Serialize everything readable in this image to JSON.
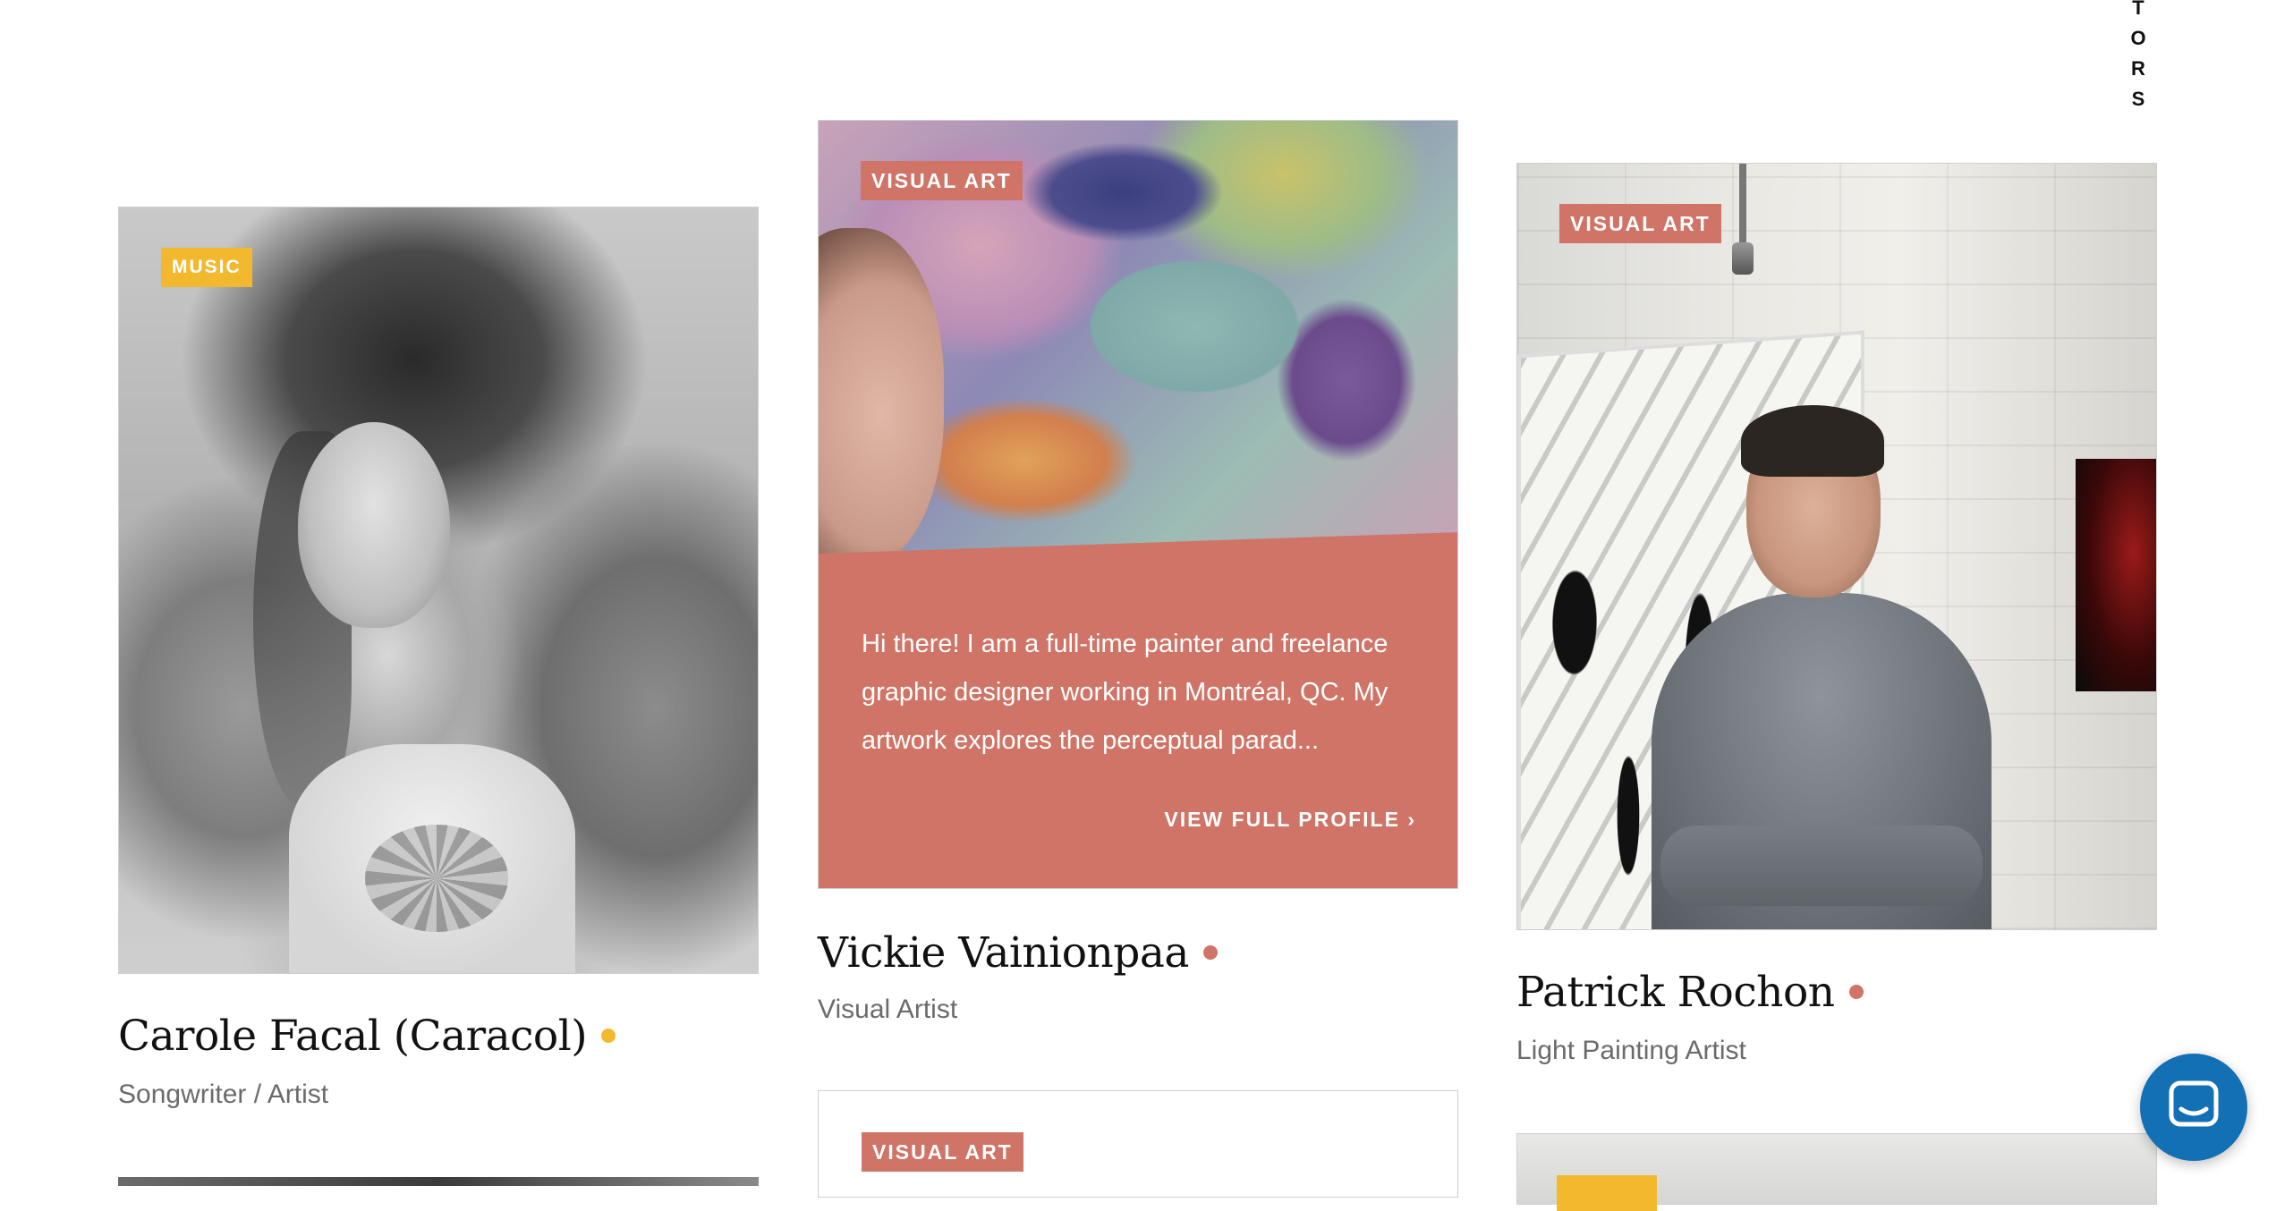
{
  "side_nav": {
    "letters": [
      "T",
      "O",
      "R",
      "S"
    ]
  },
  "cards": [
    {
      "category": "MUSIC",
      "name": "Carole Facal (Caracol)",
      "role": "Songwriter / Artist",
      "category_color": "#f2b92e"
    },
    {
      "category": "VISUAL ART",
      "name": "Vickie Vainionpaa",
      "role": "Visual Artist",
      "bio": "Hi there! I am a full-time painter and freelance graphic designer working in Montréal, QC. My artwork explores the perceptual parad...",
      "cta": "VIEW FULL PROFILE ›",
      "category_color": "#cf7466"
    },
    {
      "category": "VISUAL ART",
      "name": "Patrick Rochon",
      "role": "Light Painting Artist",
      "category_color": "#cf7466"
    }
  ],
  "next_row": {
    "middle_badge": "VISUAL ART"
  },
  "colors": {
    "music": "#f2b92e",
    "visual_art": "#cf7466",
    "chat": "#1470b4"
  },
  "icons": {
    "chat": "chat-bubble-icon"
  }
}
